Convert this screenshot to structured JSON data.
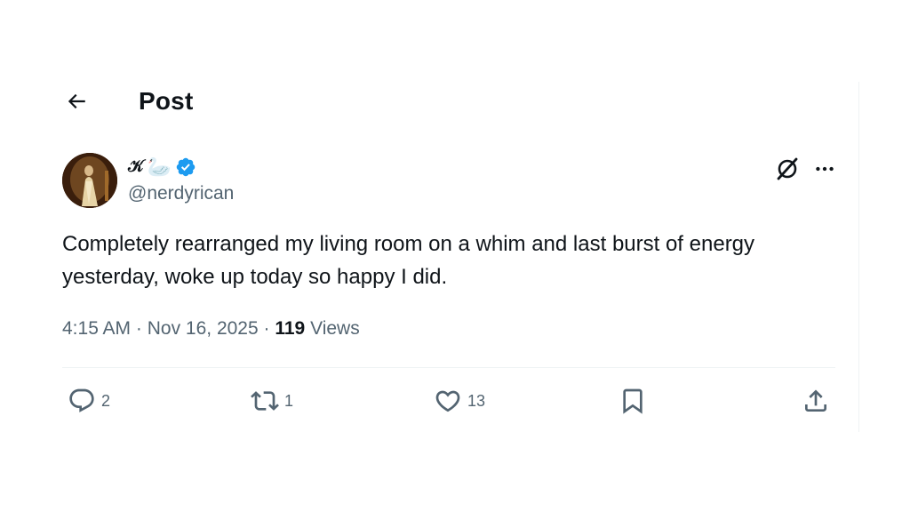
{
  "header": {
    "title": "Post",
    "back_icon": "arrow-left-icon"
  },
  "author": {
    "display_name": "𝒦",
    "emoji": "🦢",
    "verified_icon": "verified-badge-icon",
    "verified_color": "#1d9bf0",
    "handle": "@nerdyrican"
  },
  "top_actions": {
    "grok_icon": "grok-icon",
    "more_icon": "more-horizontal-icon"
  },
  "tweet": {
    "text": "Completely rearranged my living room on a whim and last burst of energy yesterday, woke up today so happy I did."
  },
  "meta": {
    "time": "4:15 AM",
    "separator": " · ",
    "date": "Nov 16, 2025",
    "views_count": "119",
    "views_label": "Views"
  },
  "actions": {
    "reply": {
      "icon": "reply-icon",
      "count": "2"
    },
    "repost": {
      "icon": "repost-icon",
      "count": "1"
    },
    "like": {
      "icon": "heart-icon",
      "count": "13"
    },
    "bookmark": {
      "icon": "bookmark-icon"
    },
    "share": {
      "icon": "share-icon"
    }
  },
  "colors": {
    "text_primary": "#0f1419",
    "text_secondary": "#536471",
    "divider": "#eff3f4",
    "accent": "#1d9bf0"
  }
}
